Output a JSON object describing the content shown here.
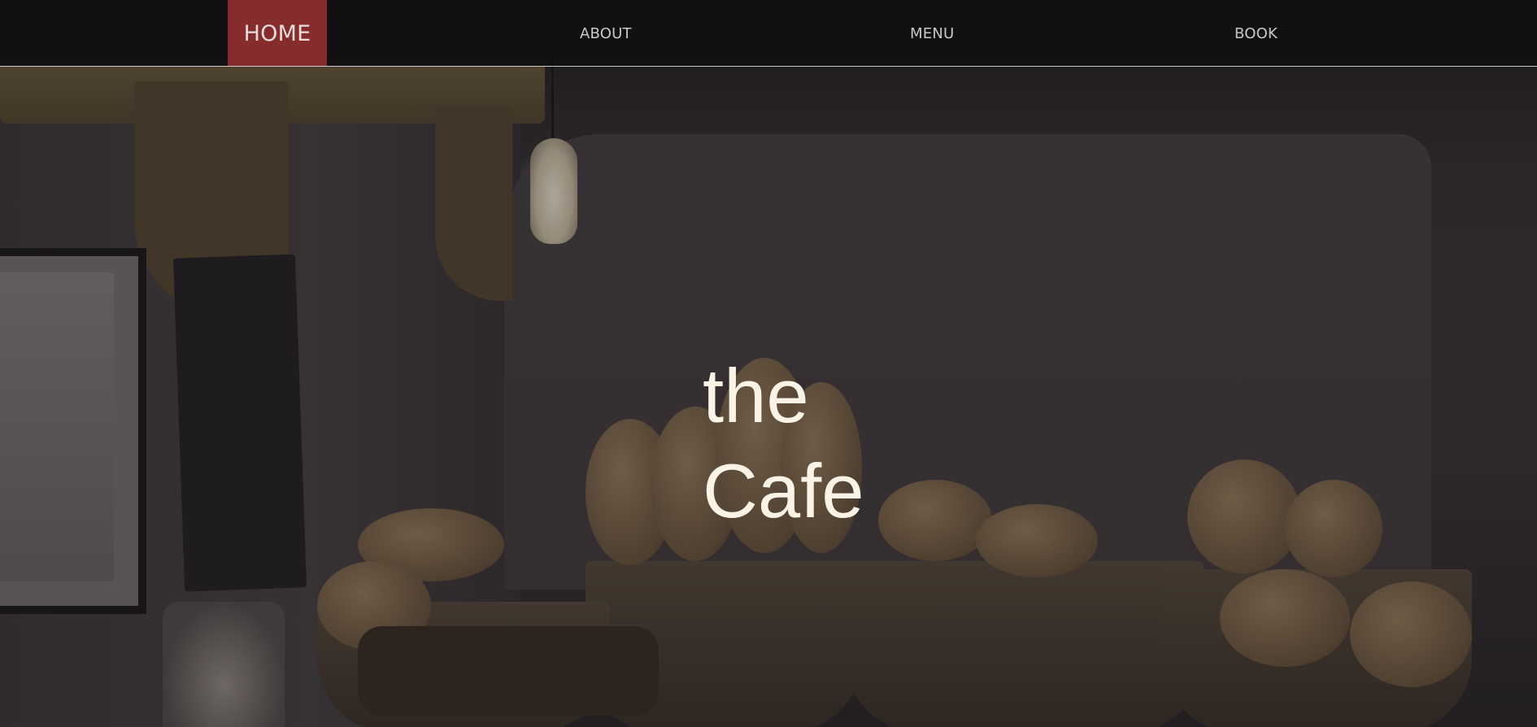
{
  "nav": {
    "home": "HOME",
    "about": "ABOUT",
    "menu": "MENU",
    "book": "BOOK"
  },
  "hero": {
    "title_line1": "the",
    "title_line2": "Cafe"
  },
  "colors": {
    "nav_active_bg": "#a83434",
    "nav_text": "#c8c8c8",
    "title_text": "#fbf4e6"
  }
}
